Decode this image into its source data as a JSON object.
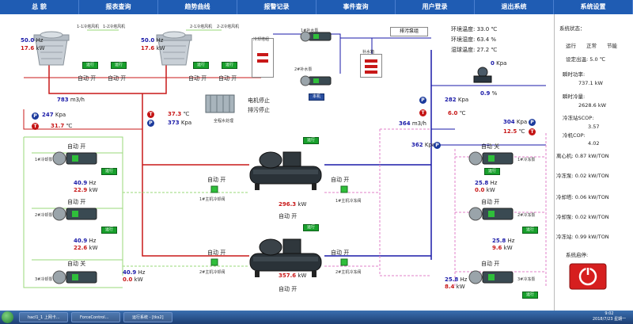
{
  "menu": [
    "总  貌",
    "报表查询",
    "趋势曲线",
    "报警记录",
    "事件查询",
    "用户登录",
    "退出系统",
    "系统设置"
  ],
  "colors": {
    "menu_bg": "#1f5cb3",
    "supply_pipe": "#c81818",
    "return_pipe": "#1a1aa8",
    "cooling_pipe": "#9ad87a",
    "dashed_pipe": "#e080c8",
    "run_button": "#18a02c"
  },
  "towers": {
    "t1": {
      "hz": "50.0",
      "kw": "17.6",
      "fan1": "1-1冷塔风机",
      "fan2": "1-2冷塔风机"
    },
    "t2": {
      "hz": "50.0",
      "kw": "17.6",
      "fan1": "2-1冷塔风机",
      "fan2": "2-2冷塔风机"
    },
    "hz_unit": "Hz",
    "kw_unit": "kW"
  },
  "run_label": "运行",
  "auto_on": "自动 开",
  "auto_off": "自动 关",
  "makeup": {
    "label1": "1#补水泵",
    "label2": "2#补水泵",
    "box_label": "补水箱",
    "tank_label": "冷却塔组",
    "this_machine": "本机"
  },
  "water_treat": {
    "label": "全程水处理",
    "status1": "电机停止",
    "status2": "排污停止"
  },
  "drain_button": "排污泵组",
  "env": {
    "temp_label": "环境温度:",
    "temp_val": "33.0",
    "temp_unit": "℃",
    "hum_label": "环境湿度:",
    "hum_val": "63.4",
    "hum_unit": "%",
    "wet_label": "湿球温度:",
    "wet_val": "27.2",
    "wet_unit": "℃"
  },
  "left_meas": {
    "flow": "783",
    "flow_unit": "m3/h",
    "p": "247",
    "p_unit": "Kpa",
    "t": "31.7",
    "t_unit": "℃",
    "t2": "37.3",
    "t2_unit": "℃",
    "p2": "373",
    "p2_unit": "Kpa"
  },
  "cooling_pumps": [
    {
      "name": "1#冷却泵",
      "status": "自动 开",
      "hz": "40.9",
      "kw": "22.9"
    },
    {
      "name": "2#冷却泵",
      "status": "自动 开",
      "hz": "40.9",
      "kw": "22.6"
    },
    {
      "name": "3#冷却泵",
      "status": "自动 关",
      "hz": "40.9",
      "kw": "0.0"
    }
  ],
  "chillers": [
    {
      "kw": "296.3",
      "kw_unit": "kW",
      "status": "自动 开",
      "valve1": "1#主机冷却阀",
      "valve2": "1#主机冷冻阀",
      "valve_status": "自动 开"
    },
    {
      "kw": "357.6",
      "kw_unit": "kW",
      "status": "自动 开",
      "valve1": "2#主机冷却阀",
      "valve2": "2#主机冷冻阀",
      "valve_status": "自动 开"
    }
  ],
  "right_meas": {
    "p_top": "0",
    "p_top_unit": "Kpa",
    "pct": "0.9",
    "pct_unit": "%",
    "p1": "282",
    "p1_unit": "Kpa",
    "t1": "6.0",
    "t1_unit": "℃",
    "flow": "364",
    "flow_unit": "m3/h",
    "p2": "362",
    "p2_unit": "Kpa",
    "p3": "304",
    "p3_unit": "Kpa",
    "t3": "12.5",
    "t3_unit": "℃"
  },
  "chilled_pumps": [
    {
      "name": "1#冷冻泵",
      "status": "自动 关",
      "hz": "25.8",
      "kw": "0.0"
    },
    {
      "name": "2#冷冻泵",
      "status": "自动 开",
      "hz": "25.8",
      "kw": "9.6"
    },
    {
      "name": "3#冷冻泵",
      "status": "自动 开",
      "hz": "25.8",
      "kw": "8.4"
    }
  ],
  "side": {
    "sys_state": "系统状态：",
    "run": "运行",
    "normal": "正常",
    "energy": "节能",
    "setpoint_label": "设定出温:",
    "setpoint": "5.0",
    "setpoint_unit": "℃",
    "inst_power_label": "瞬时功率:",
    "inst_power": "737.1",
    "inst_power_unit": "kW",
    "inst_cool_label": "瞬时冷量:",
    "inst_cool": "2628.6",
    "inst_cool_unit": "kW",
    "scop_label": "冷冻站SCOP:",
    "scop": "3.57",
    "cop_label": "冷机COP:",
    "cop": "4.02",
    "e1_label": "离心机:",
    "e1": "0.87",
    "e1_unit": "kW/TON",
    "e2_label": "冷冻泵:",
    "e2": "0.02",
    "e2_unit": "kW/TON",
    "e3_label": "冷却塔:",
    "e3": "0.06",
    "e3_unit": "kW/TON",
    "e4_label": "冷却泵:",
    "e4": "0.02",
    "e4_unit": "kW/TON",
    "e5_label": "冷冻站:",
    "e5": "0.99",
    "e5_unit": "kW/TON",
    "start_stop": "系统启停:"
  },
  "taskbar": {
    "items": [
      "hacl1_1 上网卡...",
      "ForceControl...",
      "运行系统 - [tks2]"
    ],
    "time": "9:02",
    "date": "2018/7/23 星期一"
  }
}
